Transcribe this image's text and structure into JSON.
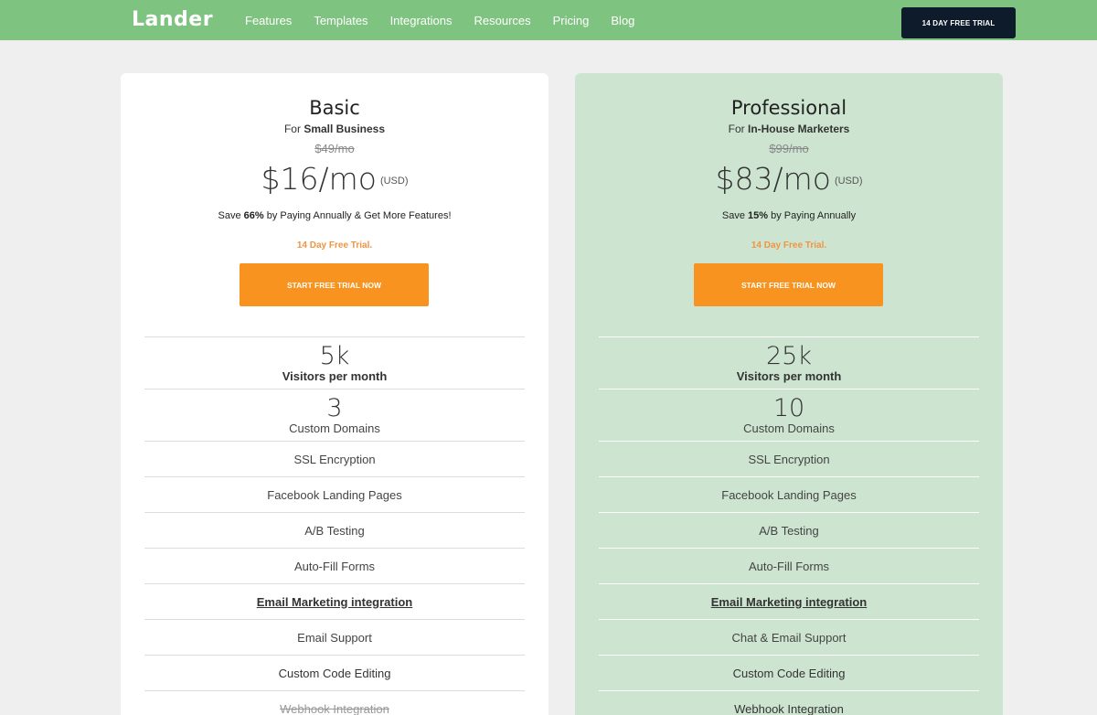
{
  "header": {
    "logo": "Lander",
    "nav": [
      "Features",
      "Templates",
      "Integrations",
      "Resources",
      "Pricing",
      "Blog"
    ],
    "cta": "14 DAY FREE TRIAL"
  },
  "plans": [
    {
      "title": "Basic",
      "for_prefix": "For ",
      "for_bold": "Small Business",
      "old_price": "$49/mo",
      "price": "$16/mo",
      "currency": "(USD)",
      "save_prefix": "Save ",
      "save_bold": "66%",
      "save_suffix": " by Paying Annually & Get More Features!",
      "trial": "14 Day Free Trial.",
      "button": "START FREE TRIAL NOW",
      "visitors_num": "5k",
      "visitors_label": "Visitors per month",
      "domains_num": "3",
      "domains_label": "Custom Domains",
      "features": [
        "SSL Encryption",
        "Facebook Landing Pages",
        "A/B Testing",
        "Auto-Fill Forms",
        "Email Marketing integration",
        "Email Support",
        "Custom Code Editing",
        "Webhook Integration"
      ]
    },
    {
      "title": "Professional",
      "for_prefix": "For ",
      "for_bold": "In-House Marketers",
      "old_price": "$99/mo",
      "price": "$83/mo",
      "currency": "(USD)",
      "save_prefix": "Save ",
      "save_bold": "15%",
      "save_suffix": " by Paying Annually",
      "trial": "14 Day Free Trial.",
      "button": "START FREE TRIAL NOW",
      "visitors_num": "25k",
      "visitors_label": "Visitors per month",
      "domains_num": "10",
      "domains_label": "Custom Domains",
      "features": [
        "SSL Encryption",
        "Facebook Landing Pages",
        "A/B Testing",
        "Auto-Fill Forms",
        "Email Marketing integration",
        "Chat & Email Support",
        "Custom Code Editing",
        "Webhook Integration"
      ]
    }
  ]
}
